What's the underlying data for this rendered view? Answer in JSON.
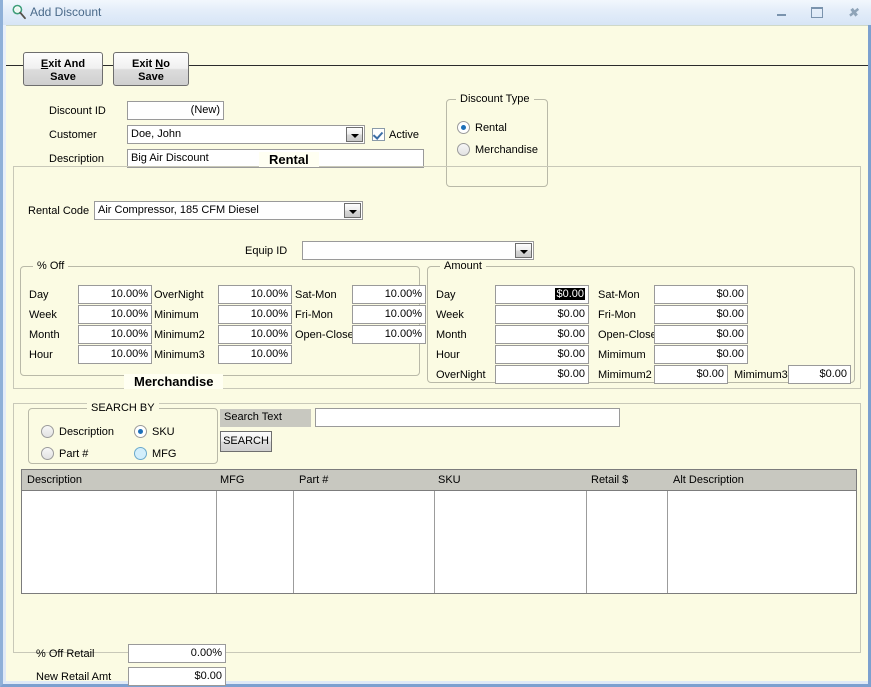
{
  "window": {
    "title": "Add Discount",
    "icon": "magnifier-icon",
    "controls": {
      "minimize": "–",
      "maximize": "▫",
      "close": "✕"
    }
  },
  "toolbar": {
    "exit_and_save": {
      "line1_pre": "E",
      "line1_post": "xit And",
      "line2": "Save"
    },
    "exit_no_save": {
      "line1_pre": "Exit ",
      "line1_accel": "N",
      "line1_post": "o",
      "line2": "Save"
    }
  },
  "form": {
    "discount_id_label": "Discount ID",
    "discount_id_value": "(New)",
    "customer_label": "Customer",
    "customer_value": "Doe, John",
    "active_label": "Active",
    "active_checked": true,
    "description_label": "Description",
    "description_value": "Big Air Discount"
  },
  "discount_type": {
    "title": "Discount Type",
    "options": [
      {
        "label": "Rental",
        "selected": true
      },
      {
        "label": "Merchandise",
        "selected": false
      }
    ]
  },
  "rental": {
    "section_title": "Rental",
    "rental_code_label": "Rental Code",
    "rental_code_value": "Air Compressor, 185 CFM  Diesel",
    "equip_id_label": "Equip ID",
    "equip_id_value": "",
    "pct_off": {
      "title": "% Off",
      "col1": [
        {
          "label": "Day",
          "value": "10.00%"
        },
        {
          "label": "Week",
          "value": "10.00%"
        },
        {
          "label": "Month",
          "value": "10.00%"
        },
        {
          "label": "Hour",
          "value": "10.00%"
        }
      ],
      "col2": [
        {
          "label": "OverNight",
          "value": "10.00%"
        },
        {
          "label": "Minimum",
          "value": "10.00%"
        },
        {
          "label": "Minimum2",
          "value": "10.00%"
        },
        {
          "label": "Minimum3",
          "value": "10.00%"
        }
      ],
      "col3": [
        {
          "label": "Sat-Mon",
          "value": "10.00%"
        },
        {
          "label": "Fri-Mon",
          "value": "10.00%"
        },
        {
          "label": "Open-Close",
          "value": "10.00%"
        }
      ]
    },
    "amount": {
      "title": "Amount",
      "col1": [
        {
          "label": "Day",
          "value": "$0.00",
          "selected": true
        },
        {
          "label": "Week",
          "value": "$0.00"
        },
        {
          "label": "Month",
          "value": "$0.00"
        },
        {
          "label": "Hour",
          "value": "$0.00"
        },
        {
          "label": "OverNight",
          "value": "$0.00"
        }
      ],
      "col2": [
        {
          "label": "Sat-Mon",
          "value": "$0.00"
        },
        {
          "label": "Fri-Mon",
          "value": "$0.00"
        },
        {
          "label": "Open-Close",
          "value": "$0.00"
        },
        {
          "label": "Mimimum",
          "value": "$0.00"
        },
        {
          "label": "Mimimum2",
          "value": "$0.00"
        }
      ],
      "extra": {
        "label": "Mimimum3",
        "value": "$0.00"
      }
    }
  },
  "merchandise": {
    "section_title": "Merchandise",
    "search_by": {
      "title": "SEARCH BY",
      "options": [
        {
          "label": "Description",
          "selected": false,
          "hover": false
        },
        {
          "label": "SKU",
          "selected": true,
          "hover": false
        },
        {
          "label": "Part #",
          "selected": false,
          "hover": false
        },
        {
          "label": "MFG",
          "selected": false,
          "hover": true
        }
      ]
    },
    "search_text_label": "Search Text",
    "search_text_value": "",
    "search_button": "SEARCH",
    "grid": {
      "columns": [
        "Description",
        "MFG",
        "Part #",
        "SKU",
        "Retail $",
        "Alt Description"
      ],
      "rows": []
    },
    "pct_off_retail_label": "% Off Retail",
    "pct_off_retail_value": "0.00%",
    "new_retail_amt_label": "New Retail Amt",
    "new_retail_amt_value": "$0.00"
  }
}
